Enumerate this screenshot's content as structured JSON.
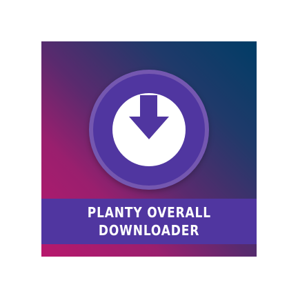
{
  "logo": {
    "title_line1": "PLANTY OVERALL",
    "title_line2": "DOWNLOADER",
    "icon": "download-arrow-icon",
    "colors": {
      "gradient_top_right": "#003d66",
      "gradient_bottom_left": "#b8186d",
      "circle": "#5036a0",
      "ring": "#7457b0",
      "banner": "#5036a0",
      "text": "#ffffff"
    }
  }
}
